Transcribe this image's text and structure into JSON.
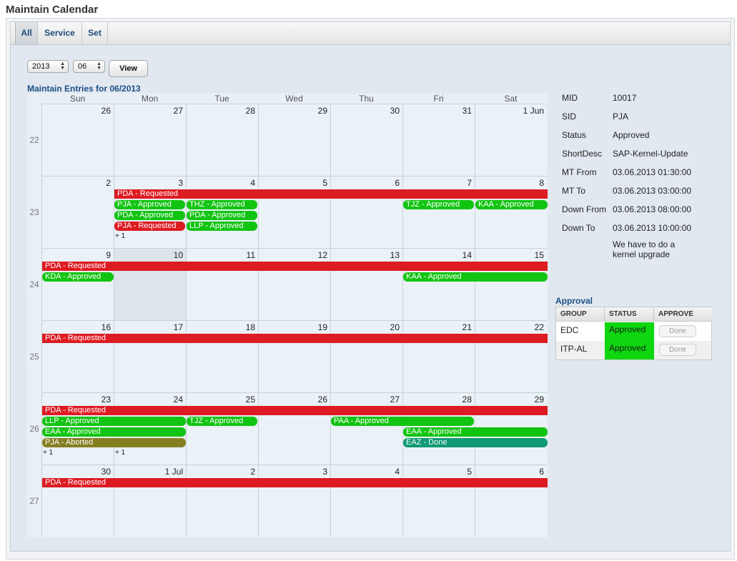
{
  "page": {
    "title": "Maintain Calendar"
  },
  "tabs": [
    "All",
    "Service",
    "Set"
  ],
  "controls": {
    "year": "2013",
    "month": "06",
    "view_label": "View"
  },
  "calendar": {
    "title": "Maintain Entries for 06/2013",
    "day_headers": [
      "Sun",
      "Mon",
      "Tue",
      "Wed",
      "Thu",
      "Fri",
      "Sat"
    ],
    "week_numbers": [
      "22",
      "23",
      "24",
      "25",
      "26",
      "27"
    ],
    "day_numbers": [
      [
        "26",
        "27",
        "28",
        "29",
        "30",
        "31",
        "1 Jun"
      ],
      [
        "2",
        "3",
        "4",
        "5",
        "6",
        "7",
        "8"
      ],
      [
        "9",
        "10",
        "11",
        "12",
        "13",
        "14",
        "15"
      ],
      [
        "16",
        "17",
        "18",
        "19",
        "20",
        "21",
        "22"
      ],
      [
        "23",
        "24",
        "25",
        "26",
        "27",
        "28",
        "29"
      ],
      [
        "30",
        "1 Jul",
        "2",
        "3",
        "4",
        "5",
        "6"
      ]
    ],
    "events": {
      "w23_pda_req": "PDA - Requested",
      "w23_pja_app": "PJA - Approved",
      "w23_pda_app": "PDA - Approved",
      "w23_pja_req": "PJA - Requested",
      "w23_thz_app": "THZ - Approved",
      "w23_pda_app2": "PDA - Approved",
      "w23_llp_app": "LLP - Approved",
      "w23_tjz_app": "TJZ - Approved",
      "w23_kaa_app": "KAA - Approved",
      "w23_more": "+ 1",
      "w24_pda_req": "PDA - Requested",
      "w24_kda_app": "KDA - Approved",
      "w24_kaa_app": "KAA - Approved",
      "w25_pda_req": "PDA - Requested",
      "w26_pda_req": "PDA - Requested",
      "w26_llp_app": "LLP - Approved",
      "w26_eaa_app": "EAA - Approved",
      "w26_pja_abort": "PJA - Aborted",
      "w26_tjz_app": "TJZ - Approved",
      "w26_paa_app": "PAA - Approved",
      "w26_eaa_app2": "EAA - Approved",
      "w26_eaz_done": "EAZ - Done",
      "w26_more_sun": "+ 1",
      "w26_more_mon": "+ 1",
      "w27_pda_req": "PDA - Requested"
    }
  },
  "details": [
    {
      "label": "MID",
      "value": "10017"
    },
    {
      "label": "SID",
      "value": "PJA"
    },
    {
      "label": "Status",
      "value": "Approved"
    },
    {
      "label": "ShortDesc",
      "value": "SAP-Kernel-Update"
    },
    {
      "label": "MT From",
      "value": "03.06.2013 01:30:00"
    },
    {
      "label": "MT To",
      "value": "03.06.2013 03:00:00"
    },
    {
      "label": "Down From",
      "value": "03.06.2013 08:00:00"
    },
    {
      "label": "Down To",
      "value": "03.06.2013 10:00:00"
    }
  ],
  "description": {
    "line1": "We have to do a",
    "line2": "kernel upgrade"
  },
  "approval": {
    "title": "Approval",
    "headers": [
      "GROUP",
      "STATUS",
      "APPROVE"
    ],
    "rows": [
      {
        "group": "EDC",
        "status": "Approved",
        "action": "Done"
      },
      {
        "group": "ITP-AL",
        "status": "Approved",
        "action": "Done"
      }
    ]
  },
  "colors": {
    "requested": "#dd1b22",
    "approved": "#12c412",
    "aborted": "#857f22",
    "done": "#0f9a73",
    "status_approved_bg": "#0fd70f"
  }
}
